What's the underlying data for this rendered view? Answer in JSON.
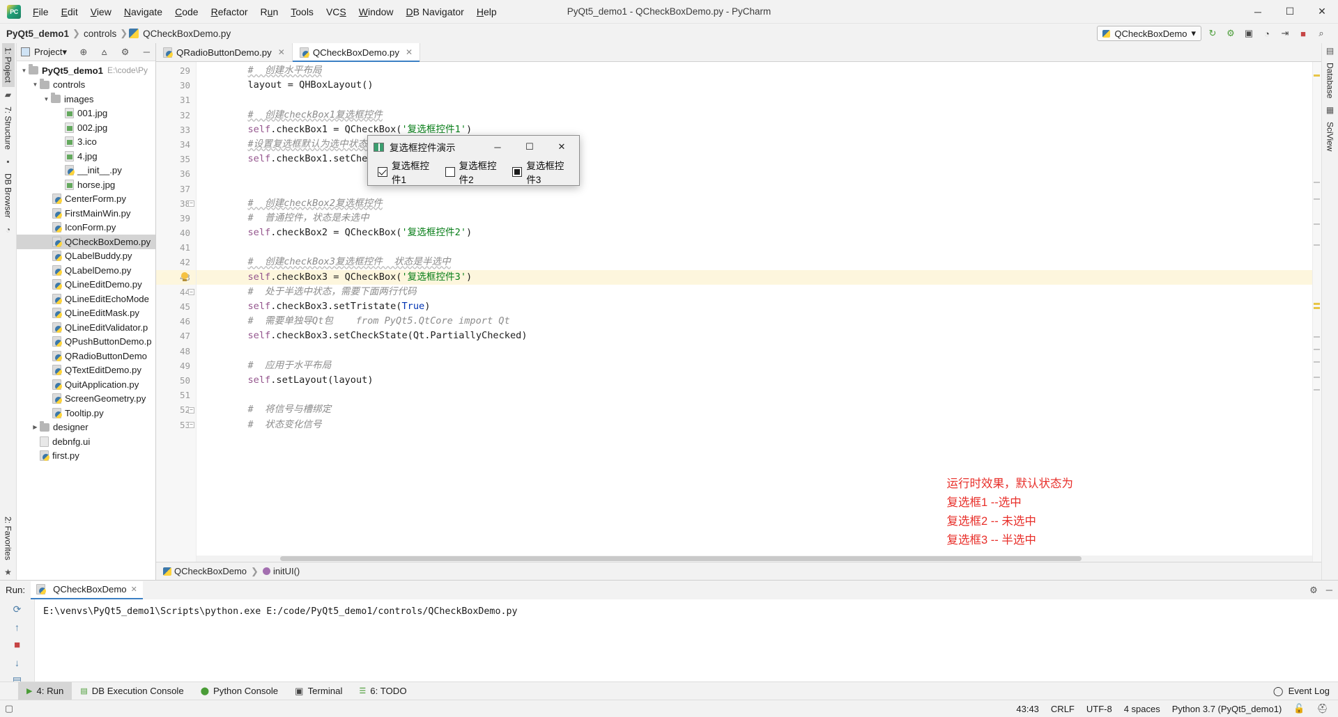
{
  "window": {
    "title": "PyQt5_demo1 - QCheckBoxDemo.py - PyCharm",
    "minimize": "─",
    "maximize": "☐",
    "close": "✕",
    "logo_icon": "pycharm-logo-icon"
  },
  "menu": [
    {
      "label": "File"
    },
    {
      "label": "Edit"
    },
    {
      "label": "View"
    },
    {
      "label": "Navigate"
    },
    {
      "label": "Code"
    },
    {
      "label": "Refactor"
    },
    {
      "label": "Run"
    },
    {
      "label": "Tools"
    },
    {
      "label": "VCS"
    },
    {
      "label": "Window"
    },
    {
      "label": "DB Navigator"
    },
    {
      "label": "Help"
    }
  ],
  "breadcrumb": {
    "project": "PyQt5_demo1",
    "folder": "controls",
    "file": "QCheckBoxDemo.py",
    "separator": "❯"
  },
  "toolbar": {
    "run_config": "QCheckBoxDemo",
    "dropdown_caret": "▾",
    "rerun": "↻",
    "debug": "⚙",
    "coverage": "▣",
    "profile": "◔",
    "attach": "⇥",
    "stop": "■",
    "search": "⌕"
  },
  "left_rail": [
    {
      "label": "1: Project",
      "active": true
    },
    {
      "label": "7: Structure",
      "active": false
    },
    {
      "label": "DB Browser",
      "active": false
    }
  ],
  "right_rail": [
    {
      "label": "Database"
    },
    {
      "label": "SciView"
    }
  ],
  "project_panel": {
    "title": "Project",
    "title_caret": "▾",
    "icons": {
      "locate": "⊕",
      "collapse": "⩟",
      "settings": "⚙",
      "hide": "─"
    },
    "tree": [
      {
        "indent": 1,
        "arrow": "▼",
        "icon": "folder",
        "label": "PyQt5_demo1",
        "bold": true,
        "path": "E:\\code\\Py",
        "selected": false
      },
      {
        "indent": 2,
        "arrow": "▼",
        "icon": "folder",
        "label": "controls",
        "bold": false,
        "path": "",
        "selected": false
      },
      {
        "indent": 3,
        "arrow": "▼",
        "icon": "folder",
        "label": "images",
        "bold": false,
        "path": "",
        "selected": false
      },
      {
        "indent": 4,
        "arrow": "",
        "icon": "image",
        "label": "001.jpg",
        "bold": false,
        "path": "",
        "selected": false
      },
      {
        "indent": 4,
        "arrow": "",
        "icon": "image",
        "label": "002.jpg",
        "bold": false,
        "path": "",
        "selected": false
      },
      {
        "indent": 4,
        "arrow": "",
        "icon": "image",
        "label": "3.ico",
        "bold": false,
        "path": "",
        "selected": false
      },
      {
        "indent": 4,
        "arrow": "",
        "icon": "image",
        "label": "4.jpg",
        "bold": false,
        "path": "",
        "selected": false
      },
      {
        "indent": 4,
        "arrow": "",
        "icon": "py",
        "label": "__init__.py",
        "bold": false,
        "path": "",
        "selected": false
      },
      {
        "indent": 4,
        "arrow": "",
        "icon": "image",
        "label": "horse.jpg",
        "bold": false,
        "path": "",
        "selected": false
      },
      {
        "indent": 5,
        "arrow": "",
        "icon": "py",
        "label": "CenterForm.py",
        "bold": false,
        "path": "",
        "selected": false
      },
      {
        "indent": 5,
        "arrow": "",
        "icon": "py",
        "label": "FirstMainWin.py",
        "bold": false,
        "path": "",
        "selected": false
      },
      {
        "indent": 5,
        "arrow": "",
        "icon": "py",
        "label": "IconForm.py",
        "bold": false,
        "path": "",
        "selected": false
      },
      {
        "indent": 5,
        "arrow": "",
        "icon": "py",
        "label": "QCheckBoxDemo.py",
        "bold": false,
        "path": "",
        "selected": true
      },
      {
        "indent": 5,
        "arrow": "",
        "icon": "py",
        "label": "QLabelBuddy.py",
        "bold": false,
        "path": "",
        "selected": false
      },
      {
        "indent": 5,
        "arrow": "",
        "icon": "py",
        "label": "QLabelDemo.py",
        "bold": false,
        "path": "",
        "selected": false
      },
      {
        "indent": 5,
        "arrow": "",
        "icon": "py",
        "label": "QLineEditDemo.py",
        "bold": false,
        "path": "",
        "selected": false
      },
      {
        "indent": 5,
        "arrow": "",
        "icon": "py",
        "label": "QLineEditEchoMode",
        "bold": false,
        "path": "",
        "selected": false
      },
      {
        "indent": 5,
        "arrow": "",
        "icon": "py",
        "label": "QLineEditMask.py",
        "bold": false,
        "path": "",
        "selected": false
      },
      {
        "indent": 5,
        "arrow": "",
        "icon": "py",
        "label": "QLineEditValidator.p",
        "bold": false,
        "path": "",
        "selected": false
      },
      {
        "indent": 5,
        "arrow": "",
        "icon": "py",
        "label": "QPushButtonDemo.p",
        "bold": false,
        "path": "",
        "selected": false
      },
      {
        "indent": 5,
        "arrow": "",
        "icon": "py",
        "label": "QRadioButtonDemo",
        "bold": false,
        "path": "",
        "selected": false
      },
      {
        "indent": 5,
        "arrow": "",
        "icon": "py",
        "label": "QTextEditDemo.py",
        "bold": false,
        "path": "",
        "selected": false
      },
      {
        "indent": 5,
        "arrow": "",
        "icon": "py",
        "label": "QuitApplication.py",
        "bold": false,
        "path": "",
        "selected": false
      },
      {
        "indent": 5,
        "arrow": "",
        "icon": "py",
        "label": "ScreenGeometry.py",
        "bold": false,
        "path": "",
        "selected": false
      },
      {
        "indent": 5,
        "arrow": "",
        "icon": "py",
        "label": "Tooltip.py",
        "bold": false,
        "path": "",
        "selected": false
      },
      {
        "indent": 2,
        "arrow": "▶",
        "icon": "folder",
        "label": "designer",
        "bold": false,
        "path": "",
        "selected": false
      },
      {
        "indent": 2,
        "arrow": "",
        "icon": "ui",
        "label": "debnfg.ui",
        "bold": false,
        "path": "",
        "selected": false
      },
      {
        "indent": 2,
        "arrow": "",
        "icon": "py",
        "label": "first.py",
        "bold": false,
        "path": "",
        "selected": false
      }
    ]
  },
  "editor_tabs": [
    {
      "label": "QRadioButtonDemo.py",
      "active": false,
      "close": "✕"
    },
    {
      "label": "QCheckBoxDemo.py",
      "active": true,
      "close": "✕"
    }
  ],
  "editor": {
    "first_line": 29,
    "highlight_line": 43,
    "lines": [
      {
        "n": 29,
        "segments": [
          {
            "t": "#  创建水平布局",
            "c": "cm-sq"
          }
        ],
        "indent": 8
      },
      {
        "n": 30,
        "segments": [
          {
            "t": "layout = QHBoxLayout()",
            "c": "fn"
          }
        ],
        "indent": 8
      },
      {
        "n": 31,
        "segments": [],
        "indent": 0
      },
      {
        "n": 32,
        "segments": [
          {
            "t": "#  创建checkBox1复选框控件",
            "c": "cm-sq"
          }
        ],
        "indent": 8
      },
      {
        "n": 33,
        "segments": [
          {
            "t": "self",
            "c": "selfk"
          },
          {
            "t": ".checkBox1 = QCheckBox(",
            "c": "fn"
          },
          {
            "t": "'复选框控件1'",
            "c": "str"
          },
          {
            "t": ")",
            "c": "fn"
          }
        ],
        "indent": 8
      },
      {
        "n": 34,
        "segments": [
          {
            "t": "#设置复选框默认为选中状态",
            "c": "cm-sq"
          }
        ],
        "indent": 8
      },
      {
        "n": 35,
        "segments": [
          {
            "t": "self",
            "c": "selfk"
          },
          {
            "t": ".checkBox1.setChe",
            "c": "fn"
          }
        ],
        "indent": 8
      },
      {
        "n": 36,
        "segments": [],
        "indent": 0
      },
      {
        "n": 37,
        "segments": [],
        "indent": 0
      },
      {
        "n": 38,
        "segments": [
          {
            "t": "#  创建checkBox2复选框控件",
            "c": "cm-sq"
          }
        ],
        "indent": 8
      },
      {
        "n": 39,
        "segments": [
          {
            "t": "#  普通控件，状态是未选中",
            "c": "cm"
          }
        ],
        "indent": 8
      },
      {
        "n": 40,
        "segments": [
          {
            "t": "self",
            "c": "selfk"
          },
          {
            "t": ".checkBox2 = QCheckBox(",
            "c": "fn"
          },
          {
            "t": "'复选框控件2'",
            "c": "str"
          },
          {
            "t": ")",
            "c": "fn"
          }
        ],
        "indent": 8
      },
      {
        "n": 41,
        "segments": [],
        "indent": 0
      },
      {
        "n": 42,
        "segments": [
          {
            "t": "#  创建checkBox3复选框控件  状态是半选中",
            "c": "cm-sq"
          }
        ],
        "indent": 8
      },
      {
        "n": 43,
        "segments": [
          {
            "t": "self",
            "c": "selfk"
          },
          {
            "t": ".checkBox3 = QCheckBox(",
            "c": "fn"
          },
          {
            "t": "'复选框控件3'",
            "c": "str"
          },
          {
            "t": ")",
            "c": "fn"
          }
        ],
        "indent": 8
      },
      {
        "n": 44,
        "segments": [
          {
            "t": "#  处于半选中状态，需要下面两行代码",
            "c": "cm"
          }
        ],
        "indent": 8
      },
      {
        "n": 45,
        "segments": [
          {
            "t": "self",
            "c": "selfk"
          },
          {
            "t": ".checkBox3.setTristate(",
            "c": "fn"
          },
          {
            "t": "True",
            "c": "kw"
          },
          {
            "t": ")",
            "c": "fn"
          }
        ],
        "indent": 8
      },
      {
        "n": 46,
        "segments": [
          {
            "t": "#  需要单独导Qt包    from PyQt5.QtCore import Qt",
            "c": "cm"
          }
        ],
        "indent": 8
      },
      {
        "n": 47,
        "segments": [
          {
            "t": "self",
            "c": "selfk"
          },
          {
            "t": ".checkBox3.setCheckState(Qt.PartiallyChecked)",
            "c": "fn"
          }
        ],
        "indent": 8
      },
      {
        "n": 48,
        "segments": [],
        "indent": 0
      },
      {
        "n": 49,
        "segments": [
          {
            "t": "#  应用于水平布局",
            "c": "cm"
          }
        ],
        "indent": 8
      },
      {
        "n": 50,
        "segments": [
          {
            "t": "self",
            "c": "selfk"
          },
          {
            "t": ".setLayout(layout)",
            "c": "fn"
          }
        ],
        "indent": 8
      },
      {
        "n": 51,
        "segments": [],
        "indent": 0
      },
      {
        "n": 52,
        "segments": [
          {
            "t": "#  将信号与槽绑定",
            "c": "cm"
          }
        ],
        "indent": 8
      },
      {
        "n": 53,
        "segments": [
          {
            "t": "#  状态变化信号",
            "c": "cm"
          }
        ],
        "indent": 8
      }
    ]
  },
  "editor_breadcrumb": {
    "class": "QCheckBoxDemo",
    "method": "initUI()",
    "separator": "❯"
  },
  "dialog": {
    "title": "复选框控件演示",
    "minimize": "─",
    "maximize": "☐",
    "close": "✕",
    "checkboxes": [
      {
        "label": "复选框控件1",
        "state": "checked"
      },
      {
        "label": "复选框控件2",
        "state": "unchecked"
      },
      {
        "label": "复选框控件3",
        "state": "partial"
      }
    ]
  },
  "annotation": {
    "color": "#e8302b",
    "lines": [
      "运行时效果，默认状态为",
      "复选框1 --选中",
      "复选框2 -- 未选中",
      "复选框3 -- 半选中"
    ]
  },
  "run_window": {
    "label": "Run:",
    "tab": "QCheckBoxDemo",
    "tab_close": "✕",
    "settings_icon": "⚙",
    "hide_icon": "─",
    "output": "E:\\venvs\\PyQt5_demo1\\Scripts\\python.exe E:/code/PyQt5_demo1/controls/QCheckBoxDemo.py",
    "side_icons": [
      "rerun-icon",
      "scroll-up-icon",
      "stop-icon",
      "scroll-down-icon",
      "print-icon",
      "wrap-icon"
    ]
  },
  "bottom_tabs": [
    {
      "label": "4: Run",
      "active": true,
      "icon": "run-icon"
    },
    {
      "label": "DB Execution Console",
      "active": false,
      "icon": "db-icon"
    },
    {
      "label": "Python Console",
      "active": false,
      "icon": "python-icon"
    },
    {
      "label": "Terminal",
      "active": false,
      "icon": "terminal-icon"
    },
    {
      "label": "6: TODO",
      "active": false,
      "icon": "todo-icon"
    }
  ],
  "bottom_right": {
    "event_log": "Event Log",
    "event_log_icon": "balloon-icon"
  },
  "statusbar": {
    "caret": "43:43",
    "line_sep": "CRLF",
    "encoding": "UTF-8",
    "indent": "4 spaces",
    "interpreter": "Python 3.7 (PyQt5_demo1)",
    "lock_icon": "🔓",
    "branch_icon": "hat-icon"
  },
  "favorites_rail": "2: Favorites"
}
